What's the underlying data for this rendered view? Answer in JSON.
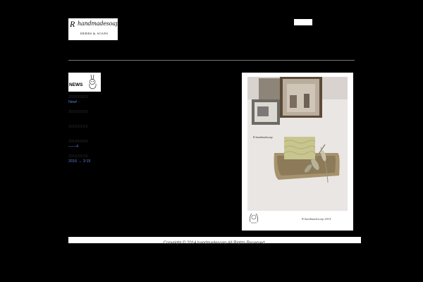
{
  "header": {
    "logo": {
      "mark": "R",
      "name": "handmadesoap",
      "tagline": "HERBS & SOAPS"
    }
  },
  "sidebar": {
    "news_title": "NEWS",
    "items": [
      {
        "date": "2016/03/23",
        "text": "New! ·"
      },
      {
        "date": "2016/02/26",
        "text": ""
      },
      {
        "date": "2015/01/22",
        "text": ""
      },
      {
        "date": "2014/03/24",
        "text": "――4"
      },
      {
        "date": "2015/01/16",
        "text": "2016 → 3:15"
      }
    ]
  },
  "photo": {
    "signature": "R handmadesoap 2014"
  },
  "footer": {
    "copyright": "Copyright © 2014 handmadesoap All Rights Reserved."
  },
  "colors": {
    "background": "#000000",
    "link": "#5a7fd6",
    "rule": "#777777"
  }
}
